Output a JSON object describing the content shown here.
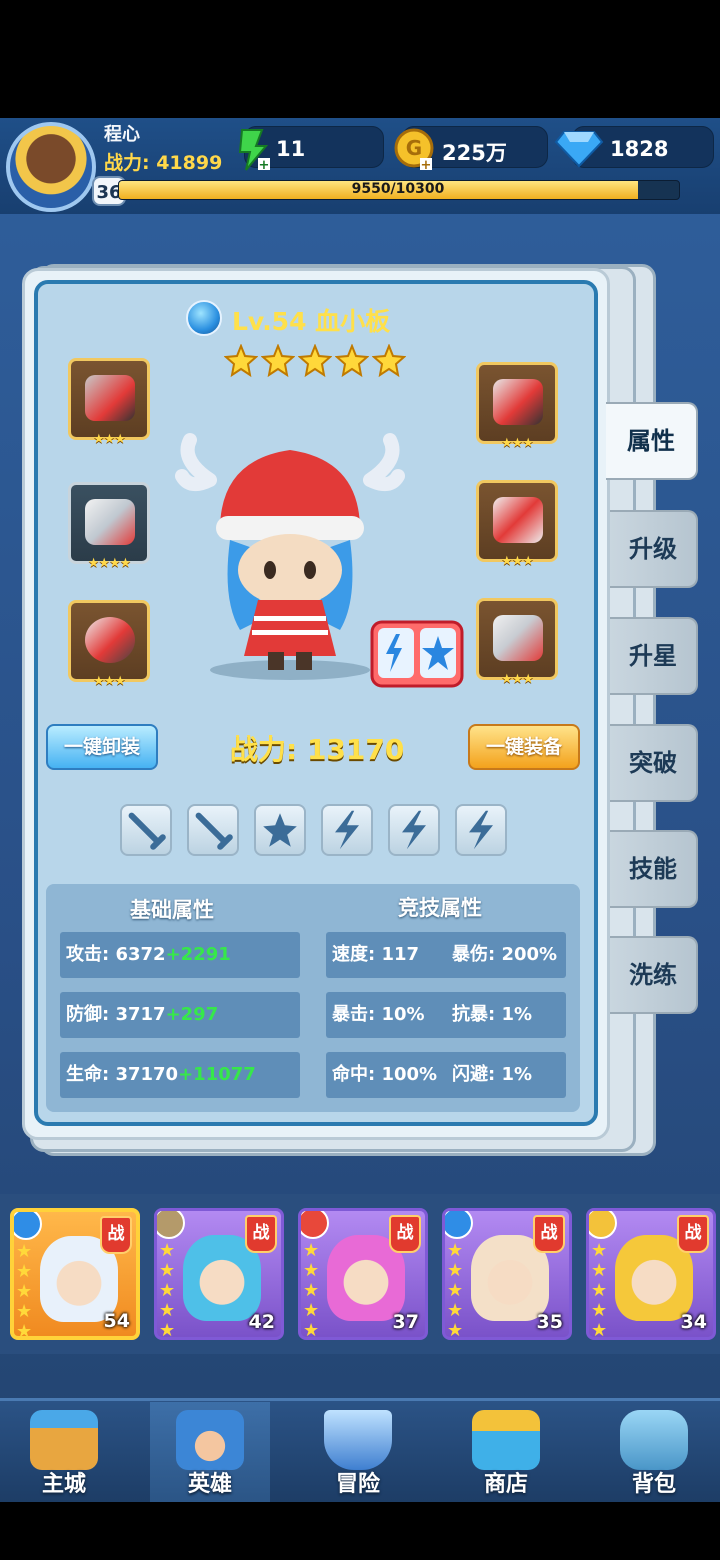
{
  "player": {
    "name": "程心",
    "power": "战力: 41899",
    "level": "36",
    "xp": "9550/10300",
    "xp_fraction": 0.927
  },
  "resources": {
    "energy": "11",
    "gold": "225万",
    "diamond": "1828"
  },
  "hero": {
    "title": "Lv.54 血小板",
    "stars": 5,
    "power": "战力: 13170"
  },
  "equipment": {
    "left": [
      {
        "name": "helmet-left",
        "stars": "★★★"
      },
      {
        "name": "gauntlet",
        "stars": "★★★★"
      },
      {
        "name": "ring",
        "stars": "★★★"
      }
    ],
    "right": [
      {
        "name": "helmet-right",
        "stars": "★★★"
      },
      {
        "name": "armor",
        "stars": "★★★"
      },
      {
        "name": "boots",
        "stars": "★★★"
      }
    ]
  },
  "buttons": {
    "unequip_all": "一键卸装",
    "equip_all": "一键装备"
  },
  "skill_slots": [
    "sword-icon",
    "sword-icon",
    "star-icon",
    "lightning-icon",
    "lightning-icon",
    "lightning-icon"
  ],
  "stats": {
    "basic_title": "基础属性",
    "arena_title": "竞技属性",
    "attack": {
      "label": "攻击: 6372",
      "bonus": "+2291"
    },
    "defense": {
      "label": "防御: 3717",
      "bonus": "+297"
    },
    "hp": {
      "label": "生命: 37170",
      "bonus": "+11077"
    },
    "speed": "速度: 117",
    "crit_dmg": "暴伤: 200%",
    "crit": "暴击: 10%",
    "crit_resist": "抗暴: 1%",
    "hit": "命中: 100%",
    "dodge": "闪避: 1%"
  },
  "tabs": [
    "属性",
    "升级",
    "升星",
    "突破",
    "技能",
    "洗练"
  ],
  "roster": [
    {
      "level": "54",
      "tag": "战",
      "stars": 5,
      "element": "water",
      "selected": true
    },
    {
      "level": "42",
      "tag": "战",
      "stars": 5,
      "element": "earth",
      "selected": false
    },
    {
      "level": "37",
      "tag": "战",
      "stars": 5,
      "element": "fire",
      "selected": false
    },
    {
      "level": "35",
      "tag": "战",
      "stars": 5,
      "element": "water",
      "selected": false
    },
    {
      "level": "34",
      "tag": "战",
      "stars": 5,
      "element": "light",
      "selected": false
    }
  ],
  "nav": [
    "主城",
    "英雄",
    "冒险",
    "商店",
    "背包"
  ],
  "colors": {
    "accent_gold": "#ffe04a",
    "bonus_green": "#36e84a",
    "panel_border": "#2a7ab0"
  }
}
